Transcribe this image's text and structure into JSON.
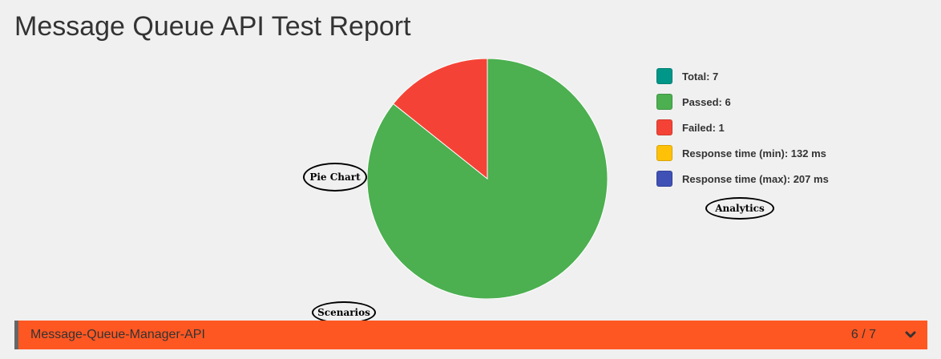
{
  "page": {
    "title": "Message Queue API Test Report"
  },
  "chart_data": {
    "type": "pie",
    "slices": [
      {
        "label": "Passed",
        "value": 6,
        "color": "#4caf50"
      },
      {
        "label": "Failed",
        "value": 1,
        "color": "#f44336"
      }
    ]
  },
  "legend": {
    "items": [
      {
        "label": "Total: 7",
        "color": "#009688"
      },
      {
        "label": "Passed: 6",
        "color": "#4caf50"
      },
      {
        "label": "Failed: 1",
        "color": "#f44336"
      },
      {
        "label": "Response time (min): 132 ms",
        "color": "#ffc107"
      },
      {
        "label": "Response time (max): 207 ms",
        "color": "#3f51b5"
      }
    ]
  },
  "annotations": {
    "pie_chart": "Pie Chart",
    "analytics": "Analytics",
    "scenarios": "Scenarios"
  },
  "scenario": {
    "name": "Message-Queue-Manager-API",
    "count": "6 / 7",
    "color": "#ff5722",
    "icon": "chevron-down-icon"
  }
}
